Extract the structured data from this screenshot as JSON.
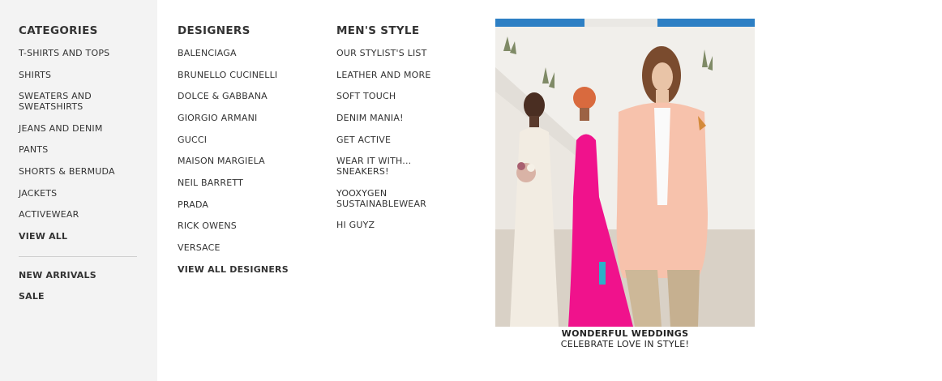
{
  "categories": {
    "heading": "CATEGORIES",
    "items": [
      "T-SHIRTS AND TOPS",
      "SHIRTS",
      "SWEATERS AND SWEATSHIRTS",
      "JEANS AND DENIM",
      "PANTS",
      "SHORTS & BERMUDA",
      "JACKETS",
      "ACTIVEWEAR"
    ],
    "view_all": "VIEW ALL",
    "new_arrivals": "NEW ARRIVALS",
    "sale": "SALE"
  },
  "designers": {
    "heading": "DESIGNERS",
    "items": [
      "BALENCIAGA",
      "BRUNELLO CUCINELLI",
      "DOLCE & GABBANA",
      "GIORGIO ARMANI",
      "GUCCI",
      "MAISON MARGIELA",
      "NEIL BARRETT",
      "PRADA",
      "RICK OWENS",
      "VERSACE"
    ],
    "view_all": "VIEW ALL DESIGNERS"
  },
  "mens_style": {
    "heading": "MEN'S STYLE",
    "items": [
      "OUR STYLIST'S LIST",
      "LEATHER AND MORE",
      "SOFT TOUCH",
      "DENIM MANIA!",
      "GET ACTIVE",
      "WEAR IT WITH... SNEAKERS!",
      "YOOXYGEN SUSTAINABLEWEAR",
      "HI GUYZ"
    ]
  },
  "promo": {
    "title": "WONDERFUL WEDDINGS",
    "subtitle": "CELEBRATE LOVE IN STYLE!"
  },
  "colors": {
    "sidebar_bg": "#f3f3f3",
    "text": "#333333",
    "accent_pink": "#f0128c",
    "blazer_peach": "#f7c2ac"
  }
}
